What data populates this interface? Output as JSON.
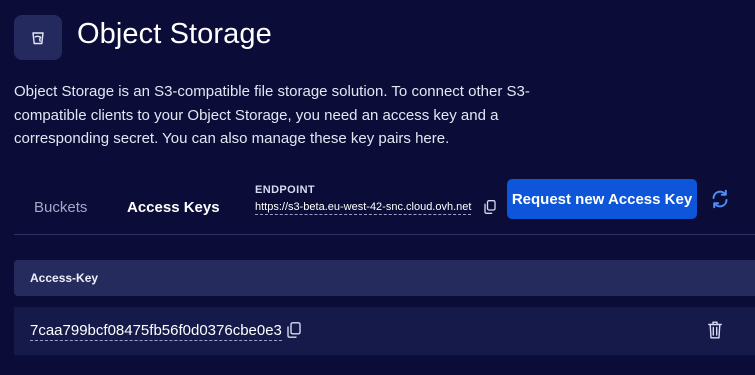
{
  "header": {
    "title": "Object Storage",
    "icon": "bucket-icon"
  },
  "description": "Object Storage is an S3-compatible file storage solution. To connect other S3-compatible clients to your Object Storage, you need an access key and a corresponding secret. You can also manage these key pairs here.",
  "tabs": [
    {
      "label": "Buckets",
      "active": false
    },
    {
      "label": "Access Keys",
      "active": true
    }
  ],
  "endpoint": {
    "label": "ENDPOINT",
    "value": "https://s3-beta.eu-west-42-snc.cloud.ovh.net",
    "copy_icon": "copy-icon"
  },
  "actions": {
    "request_label": "Request new Access Key",
    "refresh_icon": "refresh-icon"
  },
  "table": {
    "header": "Access-Key",
    "rows": [
      {
        "key": "7caa799bcf08475fb56f0d0376cbe0e3",
        "copy_icon": "copy-icon",
        "delete_icon": "trash-icon"
      }
    ]
  },
  "colors": {
    "background": "#0b0d38",
    "accent": "#0d55d9",
    "table_header": "#262b5e",
    "table_row": "#151a4a"
  }
}
